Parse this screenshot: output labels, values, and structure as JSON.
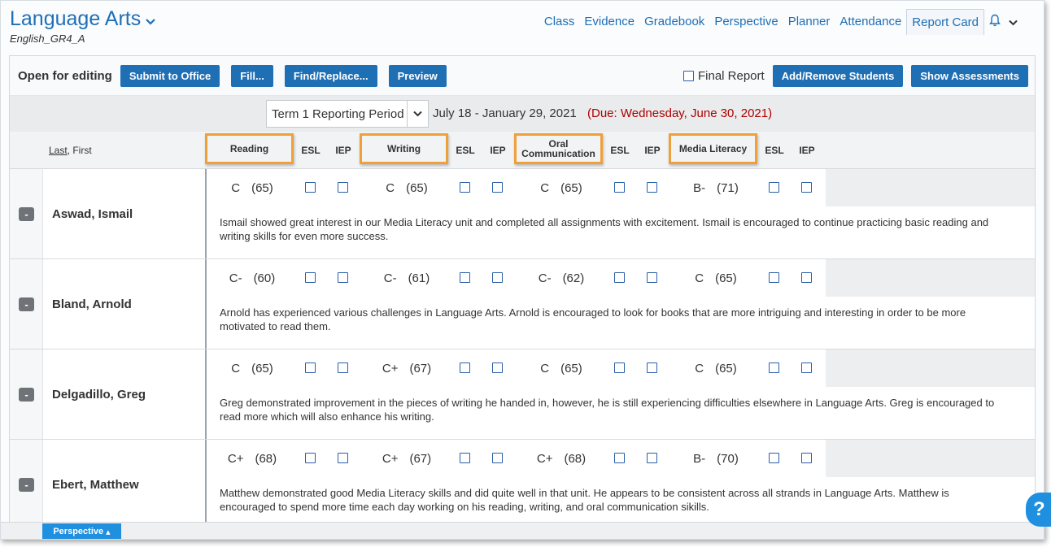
{
  "header": {
    "course_title": "Language Arts",
    "course_code": "English_GR4_A",
    "nav": [
      "Class",
      "Evidence",
      "Gradebook",
      "Perspective",
      "Planner",
      "Attendance",
      "Report Card"
    ],
    "active_nav": "Report Card"
  },
  "toolbar": {
    "status_label": "Open for editing",
    "submit_label": "Submit to Office",
    "fill_label": "Fill...",
    "find_replace_label": "Find/Replace...",
    "preview_label": "Preview",
    "final_report_label": "Final Report",
    "add_remove_label": "Add/Remove Students",
    "show_assessments_label": "Show Assessments"
  },
  "period": {
    "selected": "Term 1 Reporting Period",
    "dates": "July 18 - January 29, 2021",
    "due": "(Due: Wednesday, June 30, 2021)"
  },
  "table": {
    "name_header_last": "Last",
    "name_header_rest": ", First",
    "strands": [
      "Reading",
      "Writing",
      "Oral Communication",
      "Media Literacy"
    ],
    "flag_headers": [
      "ESL",
      "IEP"
    ],
    "students": [
      {
        "name": "Aswad, Ismail",
        "marks": [
          [
            "C",
            "(65)"
          ],
          [
            "C",
            "(65)"
          ],
          [
            "C",
            "(65)"
          ],
          [
            "B-",
            "(71)"
          ]
        ],
        "comment": "Ismail showed great interest in our Media Literacy unit and completed all assignments with excitement. Ismail is encouraged to continue practicing basic reading and writing skills for even more success."
      },
      {
        "name": "Bland, Arnold",
        "marks": [
          [
            "C-",
            "(60)"
          ],
          [
            "C-",
            "(61)"
          ],
          [
            "C-",
            "(62)"
          ],
          [
            "C",
            "(65)"
          ]
        ],
        "comment": "Arnold has experienced various challenges in Language Arts. Arnold is encouraged to look for books that are more intriguing and interesting in order to be more motivated to read them."
      },
      {
        "name": "Delgadillo, Greg",
        "marks": [
          [
            "C",
            "(65)"
          ],
          [
            "C+",
            "(67)"
          ],
          [
            "C",
            "(65)"
          ],
          [
            "C",
            "(65)"
          ]
        ],
        "comment": "Greg demonstrated improvement in the pieces of writing he handed in, however, he is still experiencing difficulties elsewhere in Language Arts. Greg is encouraged to read more which will also enhance his writing."
      },
      {
        "name": "Ebert, Matthew",
        "marks": [
          [
            "C+",
            "(68)"
          ],
          [
            "C+",
            "(67)"
          ],
          [
            "C+",
            "(68)"
          ],
          [
            "B-",
            "(70)"
          ]
        ],
        "comment": "Matthew demonstrated good Media Literacy skills and did quite well in that unit. He appears to be consistent across all strands in Language Arts. Matthew is encouraged to spend more time each day working on his reading, writing, and oral communication sikills."
      }
    ]
  },
  "footer": {
    "perspective_tab": "Perspective",
    "help_glyph": "?"
  },
  "icons": {
    "title_dropdown": "chevron-down-icon",
    "notifications": "bell-icon",
    "account_menu": "chevron-down-icon",
    "period_dropdown": "chevron-down-icon",
    "collapse_row": "minus-icon",
    "help": "help-icon"
  },
  "colors": {
    "primary": "#1f6fb5",
    "due_text": "#b00000",
    "strand_highlight": "#f0a038",
    "perspective_tab": "#1f8fe0"
  }
}
